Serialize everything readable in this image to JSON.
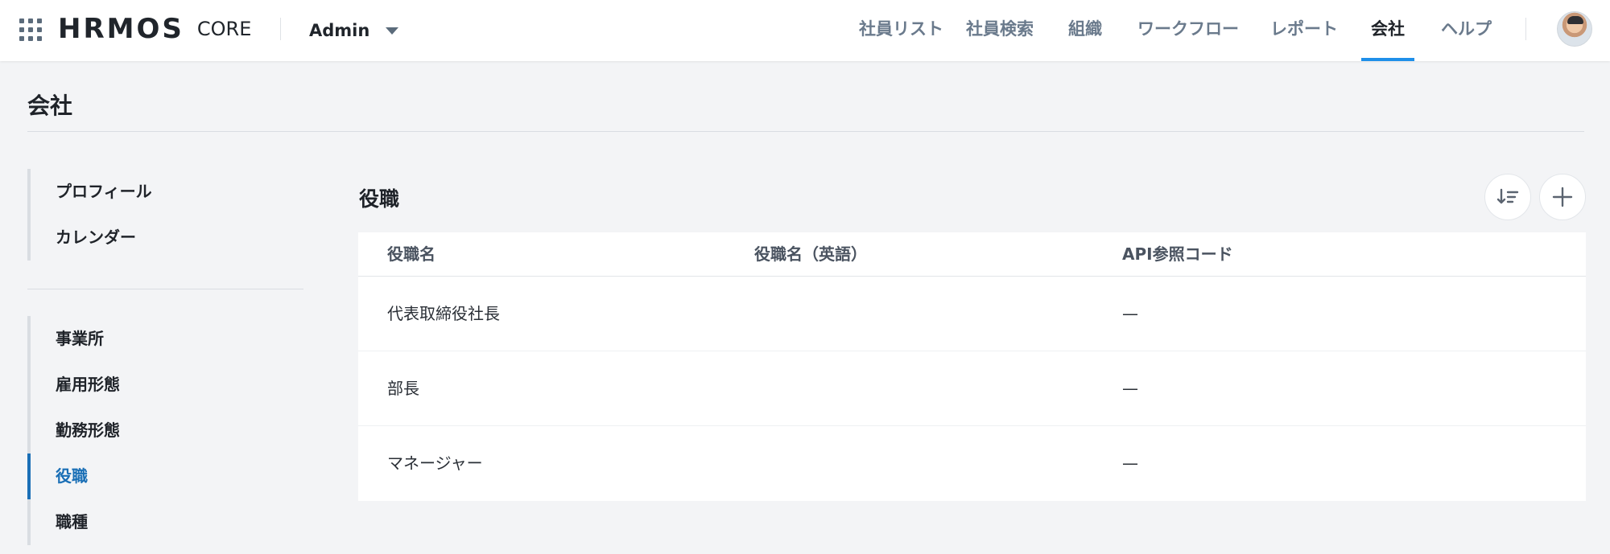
{
  "header": {
    "logo": "HRMOS",
    "product": "CORE",
    "role_label": "Admin",
    "nav": [
      {
        "label": "社員リスト",
        "active": false
      },
      {
        "label": "社員検索",
        "active": false
      },
      {
        "label": "組織",
        "active": false
      },
      {
        "label": "ワークフロー",
        "active": false
      },
      {
        "label": "レポート",
        "active": false
      },
      {
        "label": "会社",
        "active": true
      },
      {
        "label": "ヘルプ",
        "active": false
      }
    ]
  },
  "page": {
    "title": "会社"
  },
  "sidebar": {
    "group1": [
      {
        "label": "プロフィール"
      },
      {
        "label": "カレンダー"
      }
    ],
    "group2": [
      {
        "label": "事業所"
      },
      {
        "label": "雇用形態"
      },
      {
        "label": "勤務形態"
      },
      {
        "label": "役職",
        "active": true
      },
      {
        "label": "職種"
      }
    ]
  },
  "main": {
    "section_title": "役職",
    "sort_icon": "sort-icon",
    "add_icon": "plus-icon",
    "table": {
      "columns": [
        "役職名",
        "役職名（英語）",
        "API参照コード"
      ],
      "rows": [
        [
          "代表取締役社長",
          "",
          "—"
        ],
        [
          "部長",
          "",
          "—"
        ],
        [
          "マネージャー",
          "",
          "—"
        ]
      ]
    }
  },
  "colors": {
    "accent": "#1e8fe9",
    "sidebar_active": "#1a6fb6",
    "background": "#f3f4f6"
  }
}
